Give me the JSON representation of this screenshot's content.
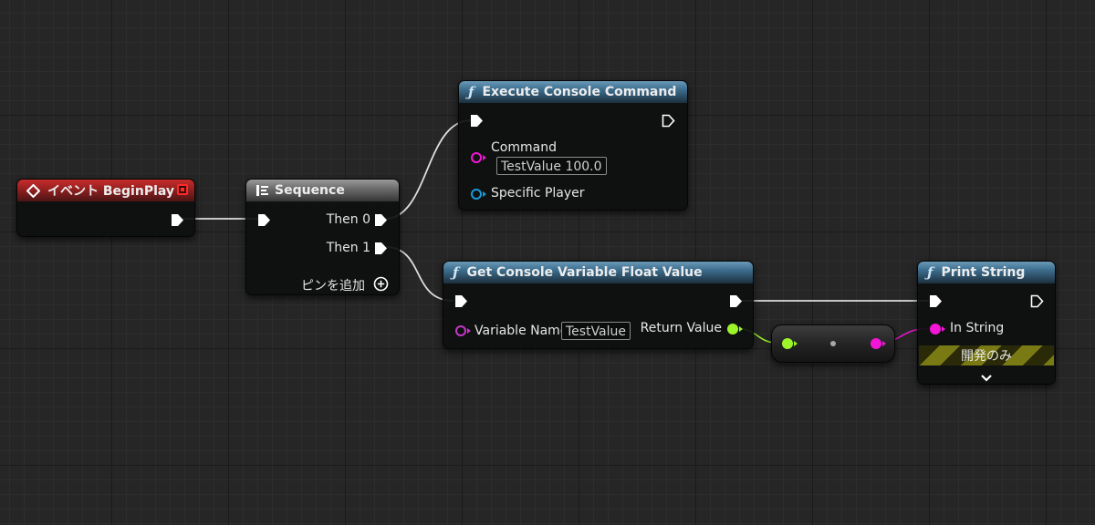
{
  "nodes": {
    "begin_play": {
      "title": "イベント BeginPlay"
    },
    "sequence": {
      "title": "Sequence",
      "then0": "Then 0",
      "then1": "Then 1",
      "add_pin": "ピンを追加"
    },
    "execute_console": {
      "title": "Execute Console Command",
      "command_label": "Command",
      "command_value": "TestValue 100.0",
      "specific_player_label": "Specific Player"
    },
    "get_console_float": {
      "title": "Get Console Variable Float Value",
      "variable_name_label": "Variable Name",
      "variable_name_value": "TestValue",
      "return_value_label": "Return Value"
    },
    "print_string": {
      "title": "Print String",
      "in_string_label": "In String",
      "dev_only": "開発のみ"
    }
  },
  "colors": {
    "exec_wire": "#ffffff",
    "float_pin": "#9cf52a",
    "string_pin": "#f316d6",
    "object_pin": "#1a9ad9",
    "name_pin": "#c837c8",
    "event_header": "#a82323",
    "function_header": "#3c6c8c"
  },
  "icons": {
    "event": "diamond-event-icon",
    "sequence": "sequence-macro-icon",
    "function": "function-f-icon",
    "add_pin": "plus-circle-icon",
    "expand": "chevron-down-icon",
    "delegate": "delegate-square-icon"
  }
}
